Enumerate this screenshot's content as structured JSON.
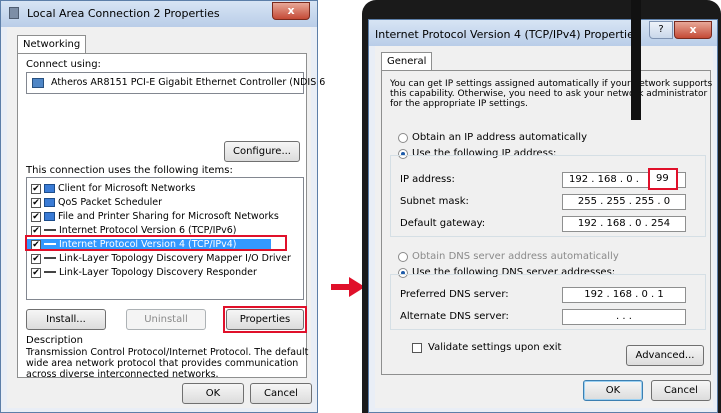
{
  "left": {
    "title": "Local Area Connection 2 Properties",
    "close": "x",
    "tab": "Networking",
    "connect_using_label": "Connect using:",
    "adapter_name": "Atheros AR8151 PCI-E Gigabit Ethernet Controller (NDIS 6",
    "configure": "Configure...",
    "items_label": "This connection uses the following items:",
    "items": [
      {
        "label": "Client for Microsoft Networks",
        "checked": "✔"
      },
      {
        "label": "QoS Packet Scheduler",
        "checked": "✔"
      },
      {
        "label": "File and Printer Sharing for Microsoft Networks",
        "checked": "✔"
      },
      {
        "label": "Internet Protocol Version 6 (TCP/IPv6)",
        "checked": "✔"
      },
      {
        "label": "Internet Protocol Version 4 (TCP/IPv4)",
        "checked": "✔"
      },
      {
        "label": "Link-Layer Topology Discovery Mapper I/O Driver",
        "checked": "✔"
      },
      {
        "label": "Link-Layer Topology Discovery Responder",
        "checked": "✔"
      }
    ],
    "install": "Install...",
    "uninstall": "Uninstall",
    "properties": "Properties",
    "description_label": "Description",
    "description_text": [
      "Transmission Control Protocol/Internet Protocol. The default",
      "wide area network protocol that provides communication",
      "across diverse interconnected networks."
    ],
    "ok": "OK",
    "cancel": "Cancel"
  },
  "right": {
    "title": "Internet Protocol Version 4 (TCP/IPv4) Properties",
    "help": "?",
    "close": "x",
    "tab": "General",
    "intro": [
      "You can get IP settings assigned automatically if your network supports",
      "this capability. Otherwise, you need to ask your network administrator",
      "for the appropriate IP settings."
    ],
    "obtain_ip": "Obtain an IP address automatically",
    "use_ip": "Use the following IP address:",
    "ip_label": "IP address:",
    "ip_value": "192 . 168 . 0 .",
    "ip_last": "99",
    "mask_label": "Subnet mask:",
    "mask_value": "255 . 255 . 255 . 0",
    "gateway_label": "Default gateway:",
    "gateway_value": "192 . 168 . 0 . 254",
    "obtain_dns": "Obtain DNS server address automatically",
    "use_dns": "Use the following DNS server addresses:",
    "pref_dns_label": "Preferred DNS server:",
    "pref_dns_value": "192 . 168 . 0 . 1",
    "alt_dns_label": "Alternate DNS server:",
    "alt_dns_value": ". . .",
    "validate": "Validate settings upon exit",
    "advanced": "Advanced...",
    "ok": "OK",
    "cancel": "Cancel"
  },
  "colors": {
    "highlight": "#e0102a",
    "selection": "#3399ff"
  }
}
